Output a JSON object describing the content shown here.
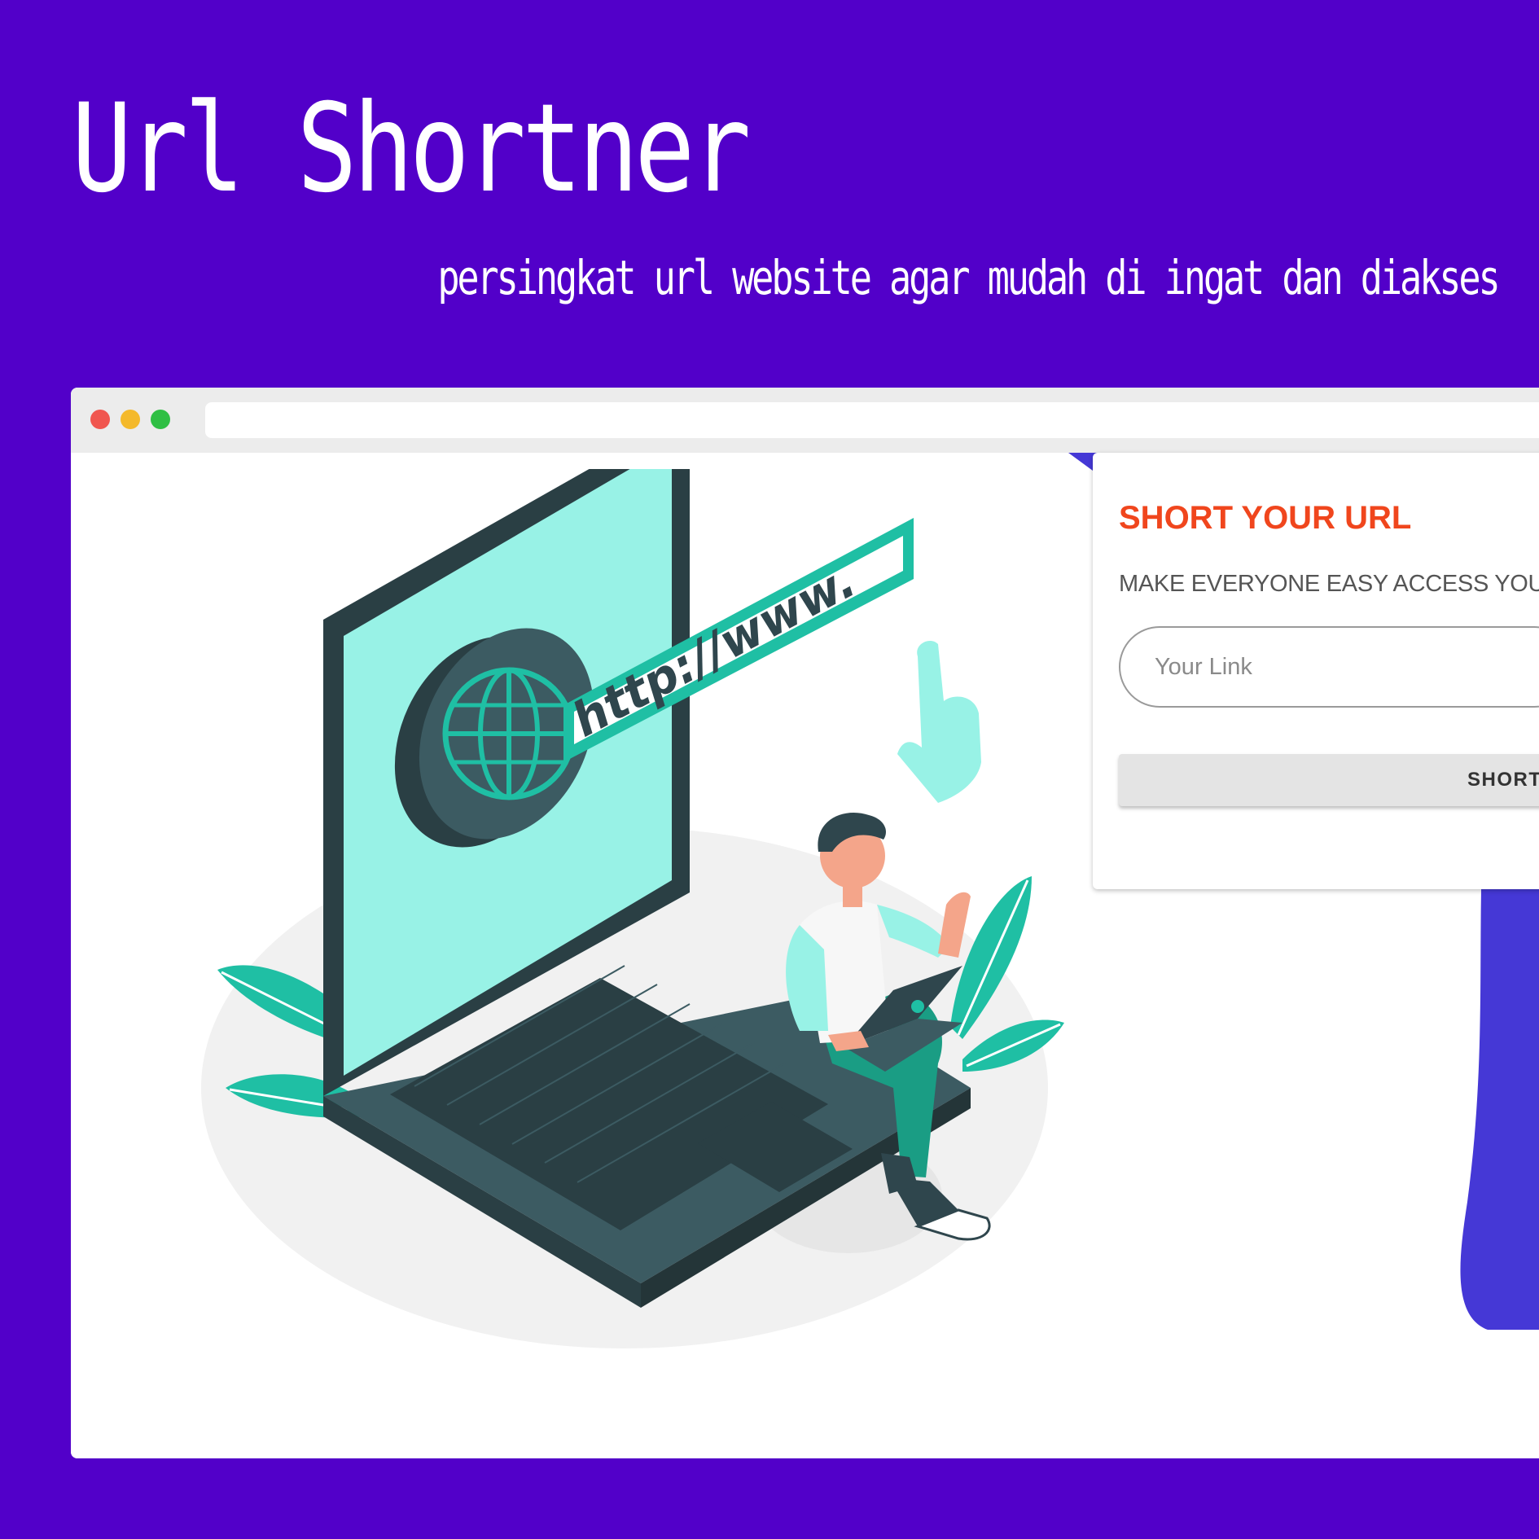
{
  "promo": {
    "title": "Url Shortner",
    "subtitle": "persingkat url website agar mudah di ingat dan diakses"
  },
  "browser": {
    "window_controls": [
      "close-dot",
      "minimize-dot",
      "maximize-dot"
    ],
    "address_value": ""
  },
  "illustration": {
    "url_banner_text": "http://www.",
    "icons": [
      "globe-icon",
      "pointer-hand-icon",
      "laptop-icon",
      "person",
      "plant-icon"
    ]
  },
  "form": {
    "title": "SHORT YOUR URL",
    "subtitle": "MAKE EVERYONE EASY ACCESS YOUR",
    "link_placeholder": "Your Link",
    "link_value": "",
    "submit_label": "SHORT"
  },
  "colors": {
    "background": "#5200c9",
    "accent_title": "#f0461d",
    "teal": "#1fbfa4",
    "mint": "#98f2e6",
    "dark_slate": "#2f464d",
    "blob": "#4538d6"
  }
}
